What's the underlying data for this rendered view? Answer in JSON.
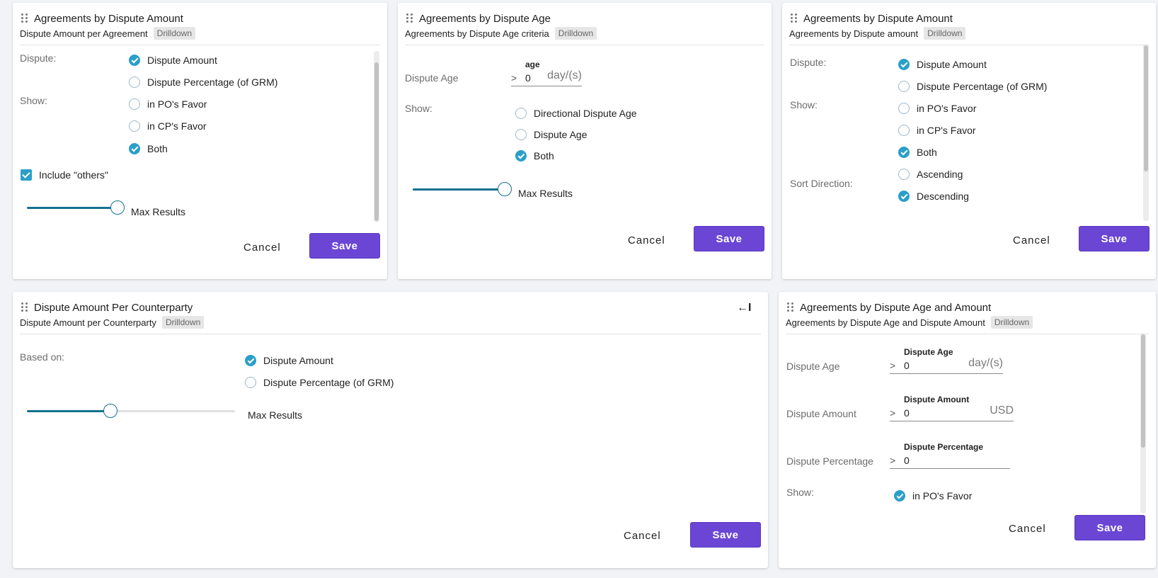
{
  "cards": {
    "c1": {
      "title": "Agreements by Dispute Amount",
      "subtitle": "Dispute Amount per Agreement",
      "chip": "Drilldown",
      "dispute_label": "Dispute:",
      "show_label": "Show:",
      "options": [
        "Dispute Amount",
        "Dispute Percentage (of GRM)",
        "in PO's Favor",
        "in CP's Favor",
        "Both"
      ],
      "checkbox_label": "Include \"others\"",
      "slider_label": "Max Results",
      "slider_value": 1.0,
      "cancel": "Cancel",
      "save": "Save"
    },
    "c2": {
      "title": "Agreements by Dispute Age",
      "subtitle": "Agreements by Dispute Age criteria",
      "chip": "Drilldown",
      "age_label": "Dispute Age",
      "field_top": "age",
      "field_gt": ">",
      "field_value": "0",
      "field_unit": "day/(s)",
      "show_label": "Show:",
      "options": [
        "Directional Dispute Age",
        "Dispute Age",
        "Both"
      ],
      "slider_label": "Max Results",
      "slider_value": 1.0,
      "cancel": "Cancel",
      "save": "Save"
    },
    "c3": {
      "title": "Agreements by Dispute Amount",
      "subtitle": "Agreements by Dispute amount",
      "chip": "Drilldown",
      "dispute_label": "Dispute:",
      "show_label": "Show:",
      "sort_label": "Sort Direction:",
      "options": [
        "Dispute Amount",
        "Dispute Percentage (of GRM)",
        "in PO's Favor",
        "in CP's Favor",
        "Both",
        "Ascending",
        "Descending"
      ],
      "cancel": "Cancel",
      "save": "Save"
    },
    "c4": {
      "title": "Dispute Amount Per Counterparty",
      "subtitle": "Dispute Amount per Counterparty",
      "chip": "Drilldown",
      "collapse_glyph": "←I",
      "based_label": "Based on:",
      "options": [
        "Dispute Amount",
        "Dispute Percentage (of GRM)"
      ],
      "slider_label": "Max Results",
      "slider_value": 0.4,
      "cancel": "Cancel",
      "save": "Save"
    },
    "c5": {
      "title": "Agreements by Dispute Age and Amount",
      "subtitle": "Agreements by Dispute Age and Dispute Amount",
      "chip": "Drilldown",
      "age_label": "Dispute Age",
      "age_field_top": "Dispute Age",
      "age_value": "0",
      "age_unit": "day/(s)",
      "amount_label": "Dispute Amount",
      "amount_field_top": "Dispute Amount",
      "amount_value": "0",
      "amount_unit": "USD",
      "pct_label": "Dispute Percentage",
      "pct_field_top": "Dispute Percentage",
      "pct_value": "0",
      "field_gt": ">",
      "show_label": "Show:",
      "options": [
        "in PO's Favor"
      ],
      "cancel": "Cancel",
      "save": "Save"
    }
  },
  "colors": {
    "accent": "#6b46d4",
    "radio_on": "#2b9fc9",
    "slider": "#15708f"
  }
}
